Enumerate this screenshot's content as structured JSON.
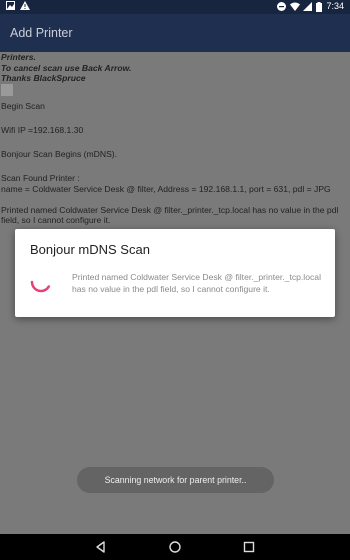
{
  "status_bar": {
    "time": "7:34"
  },
  "app_bar": {
    "title": "Add Printer"
  },
  "log": {
    "intro": [
      "Printers.",
      "To cancel scan use Back Arrow.",
      "Thanks BlackSpruce"
    ],
    "lines": [
      "Begin Scan",
      "Wifi IP =192.168.1.30",
      "Bonjour Scan Begins (mDNS).",
      "Scan Found Printer :",
      " name = Coldwater Service Desk @ filter, Address = 192.168.1.1, port = 631, pdl = JPG",
      "Printed named Coldwater Service Desk @ filter._printer._tcp.local has no value in the pdl field, so I cannot configure it."
    ]
  },
  "dialog": {
    "title": "Bonjour mDNS Scan",
    "message": "Printed named Coldwater Service Desk @ filter._printer._tcp.local has no value in the pdl field, so I cannot configure it."
  },
  "toast": {
    "text": "Scanning network for parent printer.."
  },
  "colors": {
    "accent": "#e8407a",
    "status_bar": "#18253e",
    "app_bar": "#1f2f50",
    "scrim": "#7a7a7a"
  },
  "icons": [
    "image-notification-icon",
    "warning-icon",
    "do-not-disturb-icon",
    "wifi-icon",
    "signal-icon",
    "battery-icon",
    "back-icon",
    "home-icon",
    "recents-icon"
  ]
}
